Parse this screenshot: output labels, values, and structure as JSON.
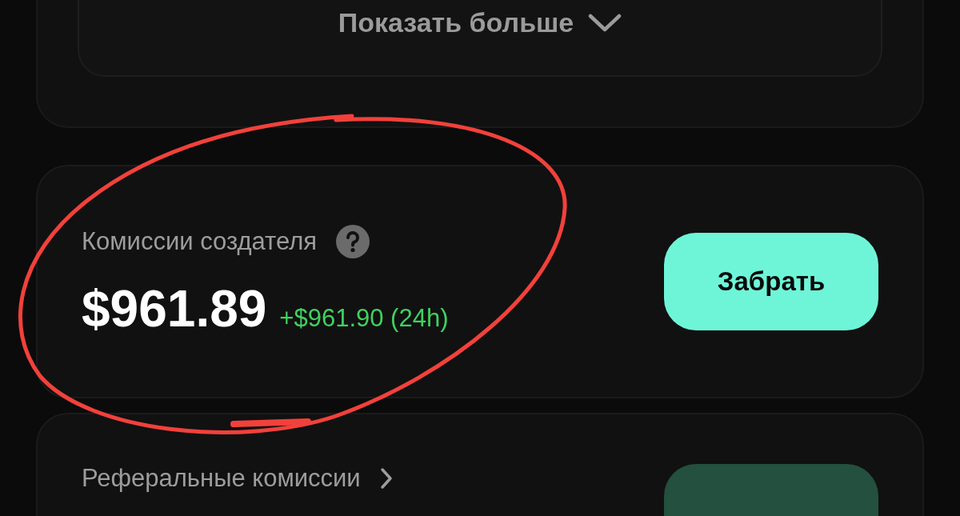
{
  "top_card": {
    "show_more": "Показать больше"
  },
  "cards": [
    {
      "title": "Комиссии создателя",
      "kind": "help",
      "amount": "$961.89",
      "change": "+$961.90 (24h)",
      "button": {
        "label": "Забрать",
        "disabled": false
      }
    },
    {
      "title": "Реферальные комиссии",
      "kind": "link",
      "button": {
        "disabled": true
      }
    }
  ]
}
